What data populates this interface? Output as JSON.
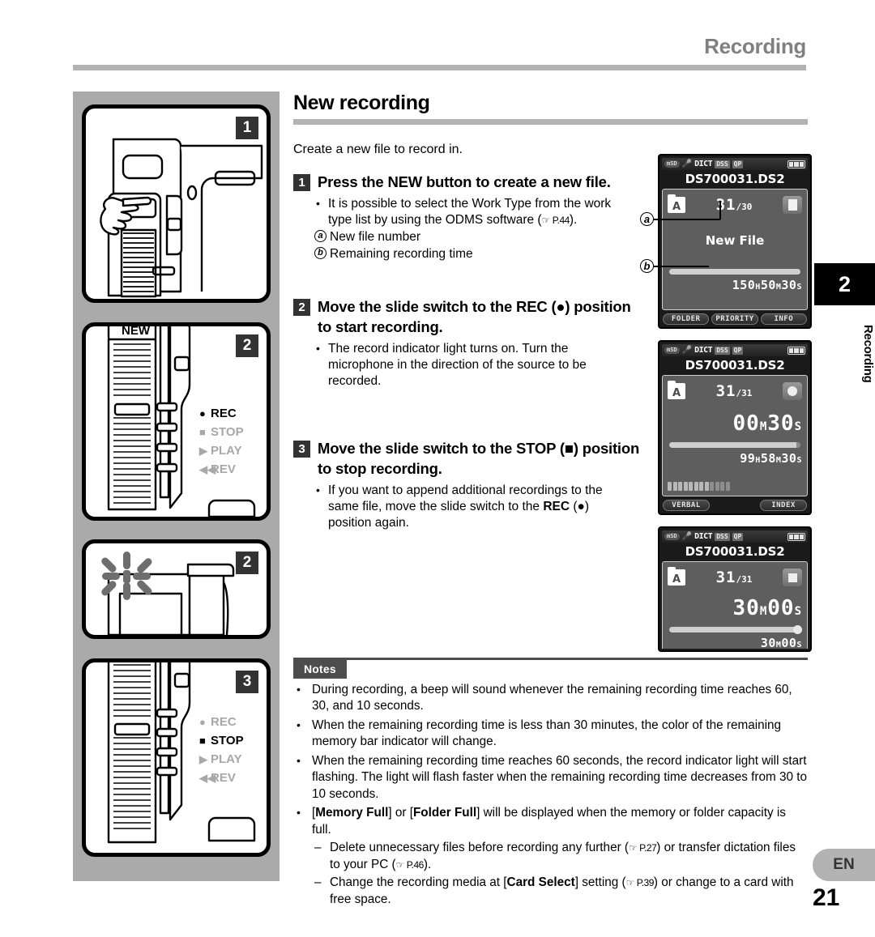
{
  "header": {
    "title": "Recording"
  },
  "section": {
    "title": "New recording",
    "intro": "Create a new file to record in."
  },
  "steps": [
    {
      "num": "1",
      "heading_part1": "Press the ",
      "heading_bold": "NEW",
      "heading_part2": " button to create a new file.",
      "bullet": "It is possible to select the Work Type from the work type list by using the ODMS software (",
      "bullet_ref": "☞ P.44",
      "bullet_end": ").",
      "callout_a_label": "a",
      "callout_a_text": "New file number",
      "callout_b_label": "b",
      "callout_b_text": "Remaining recording time"
    },
    {
      "num": "2",
      "heading_part1": "Move the slide switch to the ",
      "heading_bold": "REC",
      "heading_symbol": "(●)",
      "heading_part2": " position to start recording.",
      "bullet": "The record indicator light turns on. Turn the microphone in the direction of the source to be recorded."
    },
    {
      "num": "3",
      "heading_part1": "Move the slide switch to the ",
      "heading_bold": "STOP",
      "heading_symbol": "(■)",
      "heading_part2": " position to stop recording.",
      "bullet_part1": "If you want to append additional recordings to the same file, move the slide switch to the ",
      "bullet_bold": "REC",
      "bullet_symbol": "(●)",
      "bullet_part2": " position again."
    }
  ],
  "illustrations": {
    "panels": [
      {
        "badge": "1",
        "caption": "hand pressing NEW button on recorder"
      },
      {
        "badge": "2",
        "caption": "slide switch set to REC",
        "switch_labels": [
          {
            "glyph": "●",
            "label": "REC",
            "state": "active"
          },
          {
            "glyph": "■",
            "label": "STOP",
            "state": "inactive"
          },
          {
            "glyph": "▶",
            "label": "PLAY",
            "state": "inactive"
          },
          {
            "glyph": "◀◀",
            "label": "REV",
            "state": "inactive"
          }
        ],
        "new_button_label": "NEW"
      },
      {
        "badge": "2",
        "caption": "record indicator light flashing"
      },
      {
        "badge": "3",
        "caption": "slide switch set to STOP",
        "switch_labels": [
          {
            "glyph": "●",
            "label": "REC",
            "state": "inactive"
          },
          {
            "glyph": "■",
            "label": "STOP",
            "state": "active"
          },
          {
            "glyph": "▶",
            "label": "PLAY",
            "state": "inactive"
          },
          {
            "glyph": "◀◀",
            "label": "REV",
            "state": "inactive"
          }
        ]
      }
    ]
  },
  "lcd_screens": [
    {
      "id": "lcd-new-file",
      "status": {
        "card": "mSD",
        "mic": "DICT",
        "format": "DSS",
        "quality": "QP"
      },
      "filename": "DS700031.DS2",
      "folder": "A",
      "file_number": "31",
      "file_total": "/30",
      "mode_icon": "new-file-icon",
      "center_label": "New File",
      "remaining": {
        "h": "150",
        "h_unit": "H",
        "m": "50",
        "m_unit": "M",
        "s": "30",
        "s_unit": "S"
      },
      "softkeys": [
        "FOLDER",
        "PRIORITY",
        "INFO"
      ]
    },
    {
      "id": "lcd-recording",
      "status": {
        "card": "mSD",
        "mic": "DICT",
        "format": "DSS",
        "quality": "QP"
      },
      "filename": "DS700031.DS2",
      "folder": "A",
      "file_number": "31",
      "file_total": "/31",
      "mode_icon": "record-icon",
      "elapsed": {
        "m": "00",
        "m_unit": "M",
        "s": "30",
        "s_unit": "S"
      },
      "remaining": {
        "h": "99",
        "h_unit": "H",
        "m": "58",
        "m_unit": "M",
        "s": "30",
        "s_unit": "S"
      },
      "softkeys": [
        "VERBAL",
        "",
        "INDEX"
      ]
    },
    {
      "id": "lcd-stopped",
      "status": {
        "card": "mSD",
        "mic": "DICT",
        "format": "DSS",
        "quality": "QP"
      },
      "filename": "DS700031.DS2",
      "folder": "A",
      "file_number": "31",
      "file_total": "/31",
      "mode_icon": "stop-icon",
      "elapsed": {
        "m": "30",
        "m_unit": "M",
        "s": "00",
        "s_unit": "S"
      },
      "total": {
        "m": "30",
        "m_unit": "M",
        "s": "00",
        "s_unit": "S"
      }
    }
  ],
  "notes": {
    "label": "Notes",
    "items": [
      {
        "text": "During recording, a beep will sound whenever the remaining recording time reaches 60, 30, and 10 seconds."
      },
      {
        "text": "When the remaining recording time is less than 30 minutes, the color of the remaining memory bar indicator will change."
      },
      {
        "text": "When the remaining recording time reaches 60 seconds, the record indicator light will start flashing. The light will flash faster when the remaining recording time decreases from 30 to 10 seconds."
      }
    ],
    "memory_full": {
      "pre": "[",
      "bold1": "Memory Full",
      "mid": "] or [",
      "bold2": "Folder Full",
      "post": "] will be displayed when the memory or folder capacity is full."
    },
    "sub_items": [
      {
        "pre": "Delete unnecessary files before recording any further (",
        "ref1": "☞ P.27",
        "mid": ") or transfer dictation files to your PC (",
        "ref2": "☞ P.46",
        "post": ")."
      },
      {
        "pre": "Change the recording media at [",
        "bold": "Card Select",
        "mid": "] setting (",
        "ref1": "☞ P.39",
        "post": ") or change to a card with free space."
      }
    ]
  },
  "side_tabs": {
    "chapter_number": "2",
    "chapter_name": "Recording",
    "language": "EN",
    "page_number": "21"
  }
}
